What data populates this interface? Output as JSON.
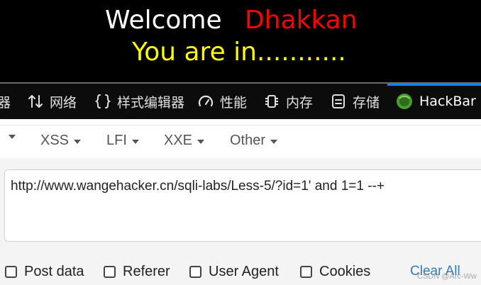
{
  "page": {
    "welcome": "Welcome",
    "username": "Dhakkan",
    "status": "You are in..........."
  },
  "devtools": {
    "tabs": [
      {
        "label": "器",
        "icon": "cut-off-tab"
      },
      {
        "label": "网络",
        "icon": "network-arrows-icon"
      },
      {
        "label": "样式编辑器",
        "icon": "braces-icon"
      },
      {
        "label": "性能",
        "icon": "gauge-icon"
      },
      {
        "label": "内存",
        "icon": "chip-icon"
      },
      {
        "label": "存储",
        "icon": "storage-icon"
      },
      {
        "label": "HackBar",
        "icon": "hackbar-logo-icon",
        "active": true
      }
    ],
    "accent": "#0a84ff"
  },
  "hackbar": {
    "menus": [
      "XSS",
      "LFI",
      "XXE",
      "Other"
    ],
    "url_value": "http://www.wangehacker.cn/sqli-labs/Less-5/?id=1' and 1=1 --+",
    "options": [
      "Post data",
      "Referer",
      "User Agent",
      "Cookies"
    ],
    "clear_all": "Clear All"
  },
  "watermark": "CSDN @Arc-Ww"
}
